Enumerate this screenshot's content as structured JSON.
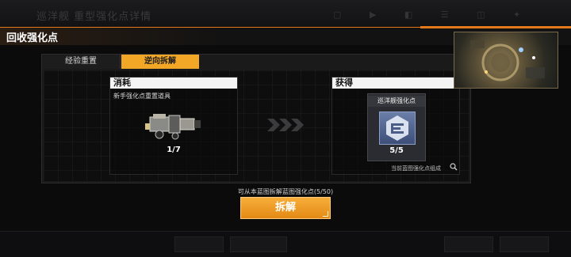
{
  "window": {
    "title": "回收强化点"
  },
  "background": {
    "ghost_title": "巡洋舰 重型强化点详情"
  },
  "tabs": [
    {
      "label": "经验重置",
      "active": false
    },
    {
      "label": "逆向拆解",
      "active": true
    }
  ],
  "consume": {
    "header": "消耗",
    "description": "新手强化点重置道具",
    "item_icon": "mechanical-module-icon",
    "count": "1/7"
  },
  "obtain": {
    "header": "获得",
    "reward_label": "巡洋舰强化点",
    "reward_icon": "cruiser-enhancement-icon",
    "count": "5/5",
    "note": "当前蓝图强化点组成"
  },
  "hint": "可从本蓝图拆解蓝图强化点(5/50)",
  "action_button": {
    "label": "拆解"
  },
  "colors": {
    "accent": "#f2a726",
    "button": "#f0a02c",
    "title_line": "#e27a1c"
  }
}
